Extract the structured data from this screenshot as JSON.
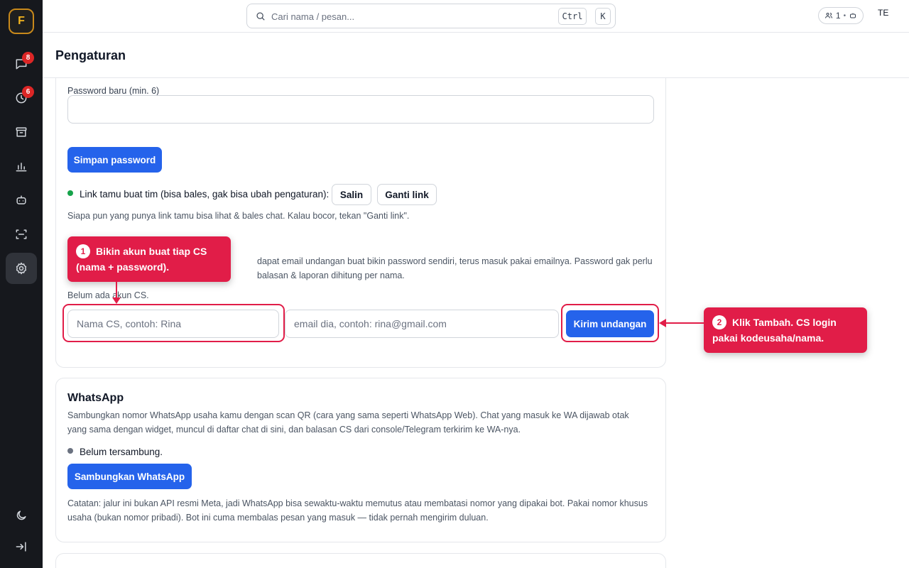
{
  "sidebar": {
    "logo_letter": "F",
    "items": [
      {
        "name": "chat",
        "icon": "chat-bubble-icon",
        "badge": "8"
      },
      {
        "name": "history",
        "icon": "clock-icon",
        "badge": "6"
      },
      {
        "name": "archive",
        "icon": "archive-box-icon",
        "badge": ""
      },
      {
        "name": "analytics",
        "icon": "bar-chart-icon",
        "badge": ""
      },
      {
        "name": "bot",
        "icon": "robot-icon",
        "badge": ""
      },
      {
        "name": "scan",
        "icon": "scan-frame-icon",
        "badge": ""
      },
      {
        "name": "settings",
        "icon": "gear-icon",
        "badge": "",
        "active": true
      }
    ],
    "bottom": [
      {
        "name": "theme",
        "icon": "moon-icon"
      },
      {
        "name": "collapse",
        "icon": "arrow-right-to-line-icon"
      }
    ]
  },
  "topbar": {
    "search_placeholder": "Cari nama / pesan...",
    "shortcut_key1": "Ctrl",
    "shortcut_key2": "K",
    "presence_count": "1",
    "presence_sep": "•",
    "user_initials": "TE"
  },
  "header": {
    "title": "Pengaturan"
  },
  "account": {
    "new_password_label": "Password baru (min. 6)",
    "new_password_value": "",
    "save_password_label": "Simpan password",
    "guest_link_text": "Link tamu buat tim (bisa bales, gak bisa ubah pengaturan):",
    "guest_link_status_color": "#16a34a",
    "copy_label": "Salin",
    "change_link_label": "Ganti link",
    "guest_link_note": "Siapa pun yang punya link tamu bisa lihat & bales chat. Kalau bocor, tekan \"Ganti link\".",
    "cs_desc_line1": "dapat email undangan buat bikin password sendiri, terus masuk pakai emailnya. Password gak perlu",
    "cs_desc_line2": "balasan & laporan dihitung per nama.",
    "no_cs_text": "Belum ada akun CS.",
    "cs_name_placeholder": "Nama CS, contoh: Rina",
    "cs_email_placeholder": "email dia, contoh: rina@gmail.com",
    "invite_label": "Kirim undangan"
  },
  "whatsapp": {
    "title": "WhatsApp",
    "description": "Sambungkan nomor WhatsApp usaha kamu dengan scan QR (cara yang sama seperti WhatsApp Web). Chat yang masuk ke WA dijawab otak yang sama dengan widget, muncul di daftar chat di sini, dan balasan CS dari console/Telegram terkirim ke WA-nya.",
    "status_text": "Belum tersambung.",
    "status_color": "#6b7280",
    "connect_label": "Sambungkan WhatsApp",
    "note": "Catatan: jalur ini bukan API resmi Meta, jadi WhatsApp bisa sewaktu-waktu memutus atau membatasi nomor yang dipakai bot. Pakai nomor khusus usaha (bukan nomor pribadi). Bot ini cuma membalas pesan yang masuk — tidak pernah mengirim duluan."
  },
  "callouts": {
    "step1_number": "1",
    "step1_text": "Bikin akun buat tiap CS (nama + password).",
    "step2_number": "2",
    "step2_text": "Klik Tambah. CS login pakai kodeusaha/nama.",
    "accent_color": "#e11d48"
  },
  "colors": {
    "primary": "#2563eb",
    "sidebar_bg": "#16181d",
    "badge": "#dc2626",
    "logo_accent": "#f5b51e"
  }
}
